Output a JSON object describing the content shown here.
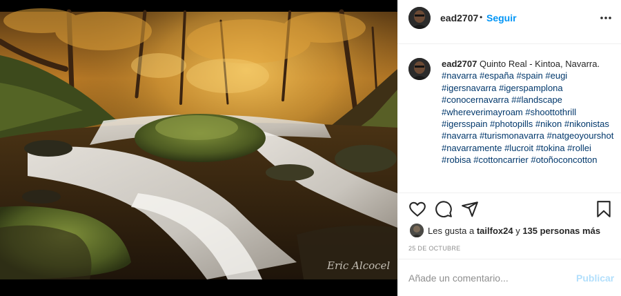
{
  "post": {
    "photo": {
      "signature_text": "Eric Alcocel",
      "colors": {
        "forest_gold": "#c98a2e",
        "forest_dark": "#3b2a12",
        "moss": "#4f6a2a",
        "water": "#e8ecef",
        "frame": "#000000"
      }
    },
    "header": {
      "username": "ead2707",
      "separator": "•",
      "follow_label": "Seguir",
      "more_icon": "more-horizontal-icon"
    },
    "caption": {
      "username": "ead2707",
      "text_lines": [
        "Quinto Real - Kintoa,",
        "Navarra."
      ],
      "hashtags": [
        "#navarra",
        "#españa",
        "#spain",
        "#eugi",
        "#igersnavarra",
        "#igerspamplona",
        "#conocernavarra",
        "##landscape",
        "#whereverimayroam",
        "#shoottothrill",
        "#igersspain",
        "#photopills",
        "#nikon",
        "#nikonistas",
        "#navarra",
        "#turismonavarra",
        "#natgeoyourshot",
        "#navarramente",
        "#lucroit",
        "#tokina",
        "#rollei",
        "#robisa",
        "#cottoncarrier",
        "#otoñoconcotton"
      ]
    },
    "actions": {
      "icons": [
        "heart-icon",
        "comment-icon",
        "share-icon",
        "bookmark-icon"
      ]
    },
    "likes": {
      "prefix": "Les gusta a ",
      "user": "tailfox24",
      "middle": " y ",
      "others": "135 personas más"
    },
    "date": "25 de octubre",
    "comment": {
      "placeholder": "Añade un comentario...",
      "publish_label": "Publicar"
    },
    "accent_colors": {
      "link": "#0095f6",
      "hashtag": "#00376b",
      "publish_disabled": "#b2dffc"
    }
  }
}
